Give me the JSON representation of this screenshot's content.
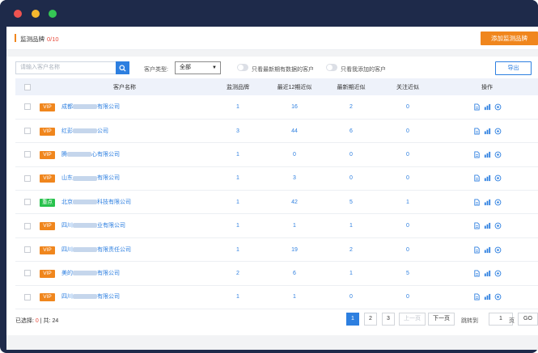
{
  "window": {
    "controls": [
      "close",
      "minimize",
      "maximize"
    ]
  },
  "topbar": {
    "title": "监测品牌",
    "count": "0/10",
    "add_label": "添加监测品牌"
  },
  "filters": {
    "search_placeholder": "请输入客户名称",
    "type_label": "客户类型:",
    "type_value": "全部",
    "toggle1_label": "只看最新期有数据的客户",
    "toggle2_label": "只看我添加的客户",
    "export_label": "导出"
  },
  "table": {
    "headers": [
      "客户名称",
      "监测品牌",
      "最近12期近似",
      "最新期近似",
      "关注近似",
      "操作"
    ],
    "rows": [
      {
        "tag": "VIP",
        "tag_type": "vip",
        "name_pre": "成都",
        "name_post": "有限公司",
        "brands": "1",
        "recent12": "16",
        "latest": "2",
        "focus": "0"
      },
      {
        "tag": "VIP",
        "tag_type": "vip",
        "name_pre": "红彭",
        "name_post": "公司",
        "brands": "3",
        "recent12": "44",
        "latest": "6",
        "focus": "0"
      },
      {
        "tag": "VIP",
        "tag_type": "vip",
        "name_pre": "腾",
        "name_post": "心有限公司",
        "brands": "1",
        "recent12": "0",
        "latest": "0",
        "focus": "0"
      },
      {
        "tag": "VIP",
        "tag_type": "vip",
        "name_pre": "山东",
        "name_post": "有限公司",
        "brands": "1",
        "recent12": "3",
        "latest": "0",
        "focus": "0"
      },
      {
        "tag": "重点",
        "tag_type": "key",
        "name_pre": "北京",
        "name_post": "科技有限公司",
        "brands": "1",
        "recent12": "42",
        "latest": "5",
        "focus": "1"
      },
      {
        "tag": "VIP",
        "tag_type": "vip",
        "name_pre": "四川",
        "name_post": "业有限公司",
        "brands": "1",
        "recent12": "1",
        "latest": "1",
        "focus": "0"
      },
      {
        "tag": "VIP",
        "tag_type": "vip",
        "name_pre": "四川",
        "name_post": "有限责任公司",
        "brands": "1",
        "recent12": "19",
        "latest": "2",
        "focus": "0"
      },
      {
        "tag": "VIP",
        "tag_type": "vip",
        "name_pre": "美的",
        "name_post": "有限公司",
        "brands": "2",
        "recent12": "6",
        "latest": "1",
        "focus": "5"
      },
      {
        "tag": "VIP",
        "tag_type": "vip",
        "name_pre": "四川",
        "name_post": "有限公司",
        "brands": "1",
        "recent12": "1",
        "latest": "0",
        "focus": "0"
      }
    ]
  },
  "footer": {
    "selected_label": "已选择:",
    "selected_count": "0",
    "total_label": "| 共:",
    "total_count": "24",
    "pages": [
      "1",
      "2",
      "3"
    ],
    "prev_label": "上一页",
    "next_label": "下一页",
    "jump_label": "跳转到",
    "jump_value": "1",
    "page_unit": "页",
    "go_label": "GO"
  },
  "colors": {
    "accent": "#f0861d",
    "primary": "#2d7fe0",
    "danger": "#e84c3d",
    "key_tag": "#27c24c"
  }
}
